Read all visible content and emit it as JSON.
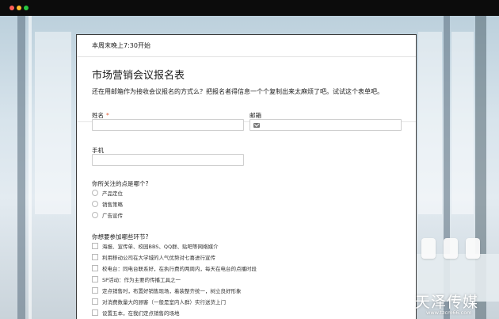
{
  "form": {
    "schedule": "本周末晚上7:30开始",
    "title": "市场营销会议报名表",
    "description": "还在用邮箱作为接收会议报名的方式么？把报名者得信息一个个复制出来太麻烦了吧。试试这个表单吧。",
    "name_label": "姓名",
    "required_mark": "*",
    "email_label": "邮箱",
    "phone_label": "手机",
    "focus_question": "你所关注的点是哪个?",
    "focus_options": [
      "产品定位",
      "销售策略",
      "广告宣传"
    ],
    "activity_question": "你想要参加哪些环节?",
    "activity_options": [
      "海报、宣传单、校园BBS、QQ群、贴吧等网络媒介",
      "利用移动公司在大学城的人气优势对七喜进行宣传",
      "校电台：同电台联系好，在执行费的两周内，每天在电台的点播时段",
      "SP活动：作为主要的传播工具之一",
      "定点销售时，布置好销售现场，着装整齐统一，树立良好形象",
      "对消费数量大的顾客（一般是室内人群）实行送货上门",
      "设置五本，在我们定点销售的场地"
    ]
  },
  "watermark": {
    "brand": "天泽传媒",
    "url": "www.tzcm66.com"
  },
  "colors": {
    "required": "#e05c35",
    "titlebar": "#0c0c0c",
    "close": "#ff5f57",
    "minimize": "#febc2e",
    "maximize": "#28c840"
  }
}
